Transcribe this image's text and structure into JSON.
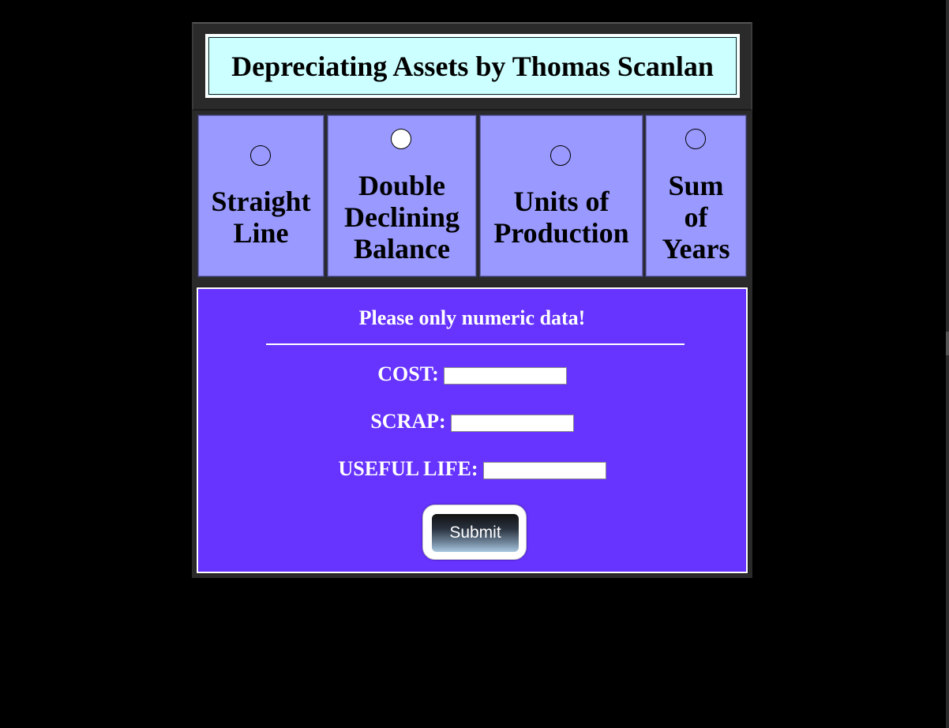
{
  "header": {
    "title": "Depreciating Assets by Thomas Scanlan"
  },
  "methods": {
    "selected": "Double Declining Balance",
    "options": [
      {
        "label": "Straight\nLine",
        "checked": false
      },
      {
        "label": "Double\nDeclining\nBalance",
        "checked": true
      },
      {
        "label": "Units of\nProduction",
        "checked": false
      },
      {
        "label": "Sum\nof\nYears",
        "checked": false
      }
    ]
  },
  "form": {
    "notice": "Please only numeric data!",
    "cost_label": "COST:",
    "cost_value": "",
    "scrap_label": "SCRAP:",
    "scrap_value": "",
    "life_label": "USEFUL LIFE:",
    "life_value": "",
    "submit_label": "Submit"
  },
  "colors": {
    "page_background": "#000000",
    "header_background": "#ccffff",
    "option_background": "#9999ff",
    "form_background": "#6633ff",
    "frame": "#2a2a2a"
  }
}
